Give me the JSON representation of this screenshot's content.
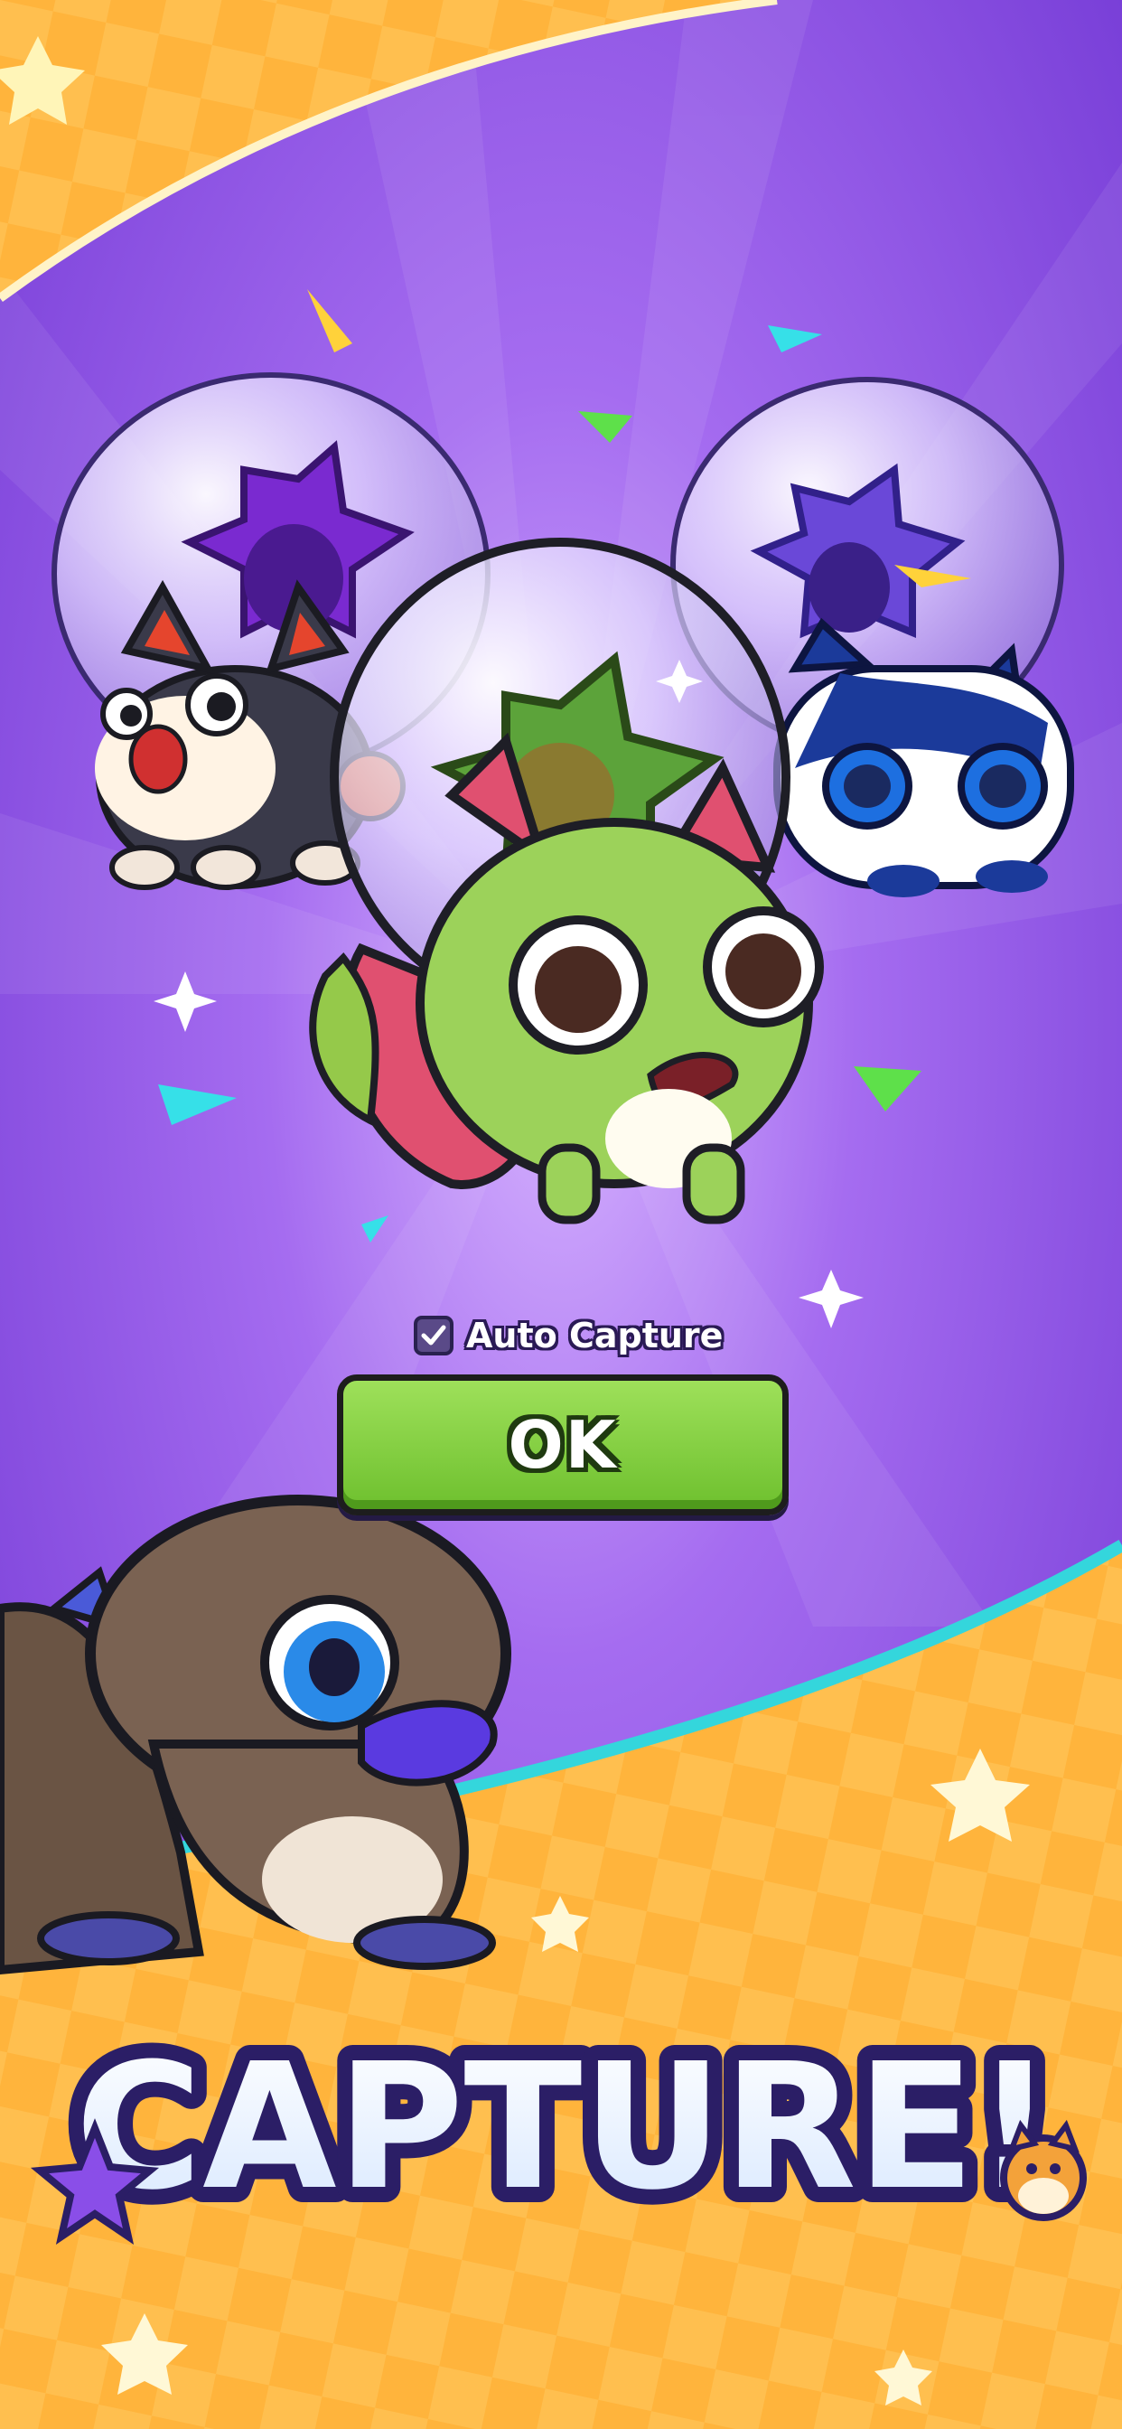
{
  "auto_capture": {
    "label": "Auto Capture",
    "checked": true
  },
  "ok_button": {
    "label": "OK"
  },
  "banner": {
    "title": "CAPTURE!"
  },
  "colors": {
    "background_purple": "#8a4fe0",
    "banner_orange": "#ffb23a",
    "ok_green": "#7ed23e",
    "title_white": "#ffffff",
    "title_outline": "#2b1e66"
  },
  "icons": [
    "sparkle-star-icon",
    "checkmark-icon",
    "confetti",
    "creature-bubble"
  ]
}
